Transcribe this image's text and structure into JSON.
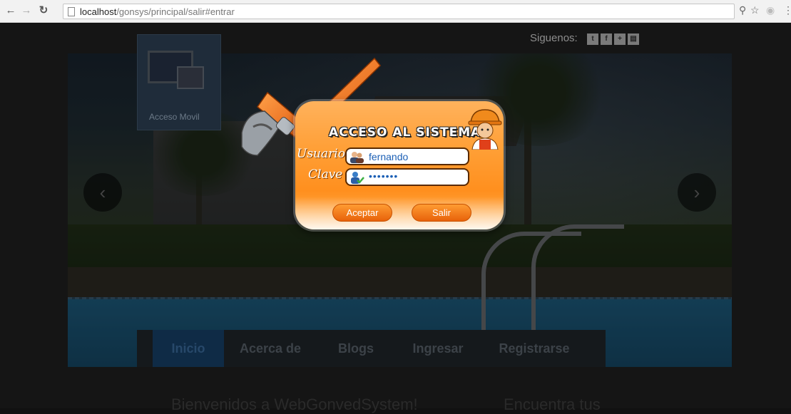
{
  "browser": {
    "url_host": "localhost",
    "url_path": "/gonsys/principal/salir#entrar",
    "back_icon": "back-arrow-icon",
    "forward_icon": "forward-arrow-icon",
    "reload_icon": "reload-icon"
  },
  "social": {
    "label": "Siguenos:",
    "icons": [
      "twitter-icon",
      "facebook-icon",
      "plus-icon",
      "rss-icon"
    ]
  },
  "mobile_tile": {
    "label": "Acceso Movil"
  },
  "menu": {
    "items": [
      {
        "label": "Inicio",
        "active": true
      },
      {
        "label": "Acerca de",
        "active": false
      },
      {
        "label": "Blogs",
        "active": false
      },
      {
        "label": "Ingresar",
        "active": false
      },
      {
        "label": "Registrarse",
        "active": false
      }
    ]
  },
  "bottom": {
    "left_text": "Bienvenidos a WebGonvedSystem!",
    "right_text": "Encuentra tus"
  },
  "login": {
    "title": "ACCESO AL SISTEMA",
    "user_label": "Usuario",
    "user_value": "fernando",
    "pass_label": "Clave",
    "pass_value": "•••••••",
    "accept_label": "Aceptar",
    "exit_label": "Salir"
  },
  "colors": {
    "dialog_orange": "#ff9e34",
    "menu_active": "#0f2b46",
    "input_text": "#1b5fb5"
  }
}
